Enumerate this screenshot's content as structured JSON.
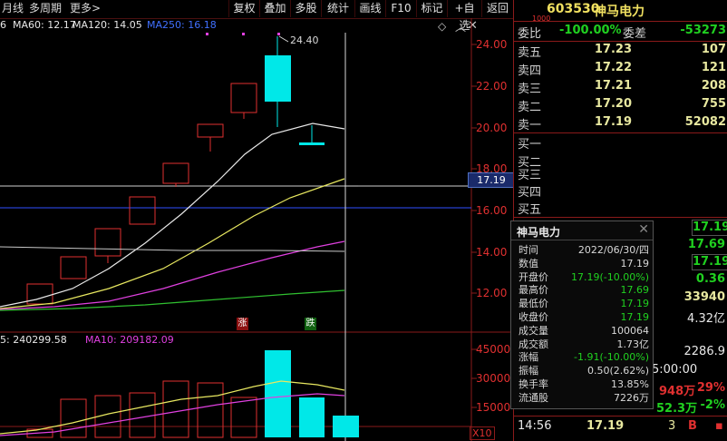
{
  "toolbar": {
    "left_items": [
      "月线",
      "多周期",
      "更多"
    ],
    "buttons": [
      "复权",
      "叠加",
      "多股",
      "统计",
      "画线",
      "F10",
      "标记",
      "+自选",
      "返回"
    ]
  },
  "ma_legend": {
    "ma60": "MA60: 12.17",
    "ma120": "MA120: 14.05",
    "ma250": "MA250: 16.18"
  },
  "price_axis": [
    "24.00",
    "22.00",
    "20.00",
    "18.00",
    "16.00",
    "14.00",
    "12.00"
  ],
  "price_marker": "17.19",
  "high_annotation": "24.40",
  "candle_labels": {
    "up": "涨",
    "down": "跌"
  },
  "volume_legend": {
    "vol": "5: 240299.58",
    "ma10": "MA10: 209182.09"
  },
  "volume_axis": [
    "45000",
    "30000",
    "15000"
  ],
  "volume_unit": "X10",
  "stock": {
    "code": "603530",
    "name": "神马电力",
    "small_tag": "1000"
  },
  "order_ratio": {
    "label_wb": "委比",
    "wb": "-100.00%",
    "label_wc": "委差",
    "wc": "-53273"
  },
  "asks": [
    {
      "label": "卖五",
      "price": "17.23",
      "vol": "107"
    },
    {
      "label": "卖四",
      "price": "17.22",
      "vol": "121"
    },
    {
      "label": "卖三",
      "price": "17.21",
      "vol": "208"
    },
    {
      "label": "卖二",
      "price": "17.20",
      "vol": "755"
    },
    {
      "label": "卖一",
      "price": "17.19",
      "vol": "52082"
    }
  ],
  "bids": [
    {
      "label": "买一"
    },
    {
      "label": "买二"
    },
    {
      "label": "买三"
    },
    {
      "label": "买四"
    },
    {
      "label": "买五"
    }
  ],
  "quote_right": [
    "17.19",
    "17.69",
    "17.19",
    "0.36",
    "33940",
    "4.32亿",
    "2286.9",
    "5:00:00"
  ],
  "quote_bottom": {
    "a": "948万",
    "a_pct": "29%",
    "b": "52.3万",
    "b_pct": "-2%"
  },
  "trade_rows": [
    {
      "time": "14:56",
      "price": "17.19",
      "qty": "3",
      "side": "B"
    }
  ],
  "tooltip": {
    "title": "神马电力",
    "rows": [
      {
        "k": "时间",
        "v": "2022/06/30/四",
        "c": "#d8d8d8"
      },
      {
        "k": "数值",
        "v": "17.19",
        "c": "#d8d8d8"
      },
      {
        "k": "开盘价",
        "v": "17.19(-10.00%)",
        "c": "#20d020"
      },
      {
        "k": "最高价",
        "v": "17.69",
        "c": "#20d020"
      },
      {
        "k": "最低价",
        "v": "17.19",
        "c": "#20d020"
      },
      {
        "k": "收盘价",
        "v": "17.19",
        "c": "#20d020"
      },
      {
        "k": "成交量",
        "v": "100064",
        "c": "#d8d8d8"
      },
      {
        "k": "成交额",
        "v": "1.73亿",
        "c": "#d8d8d8"
      },
      {
        "k": "涨幅",
        "v": "-1.91(-10.00%)",
        "c": "#20d020"
      },
      {
        "k": "振幅",
        "v": "0.50(2.62%)",
        "c": "#d8d8d8"
      },
      {
        "k": "换手率",
        "v": "13.85%",
        "c": "#d8d8d8"
      },
      {
        "k": "流通股",
        "v": "7226万",
        "c": "#d8d8d8"
      }
    ]
  },
  "colors": {
    "up": "#e03030",
    "down": "#00e8e8",
    "ma_white": "#e8e8e8",
    "ma_yellow": "#e8e860",
    "ma_magenta": "#e040e0",
    "ma_green": "#30c030",
    "ma250_blue": "#3060ff"
  }
}
